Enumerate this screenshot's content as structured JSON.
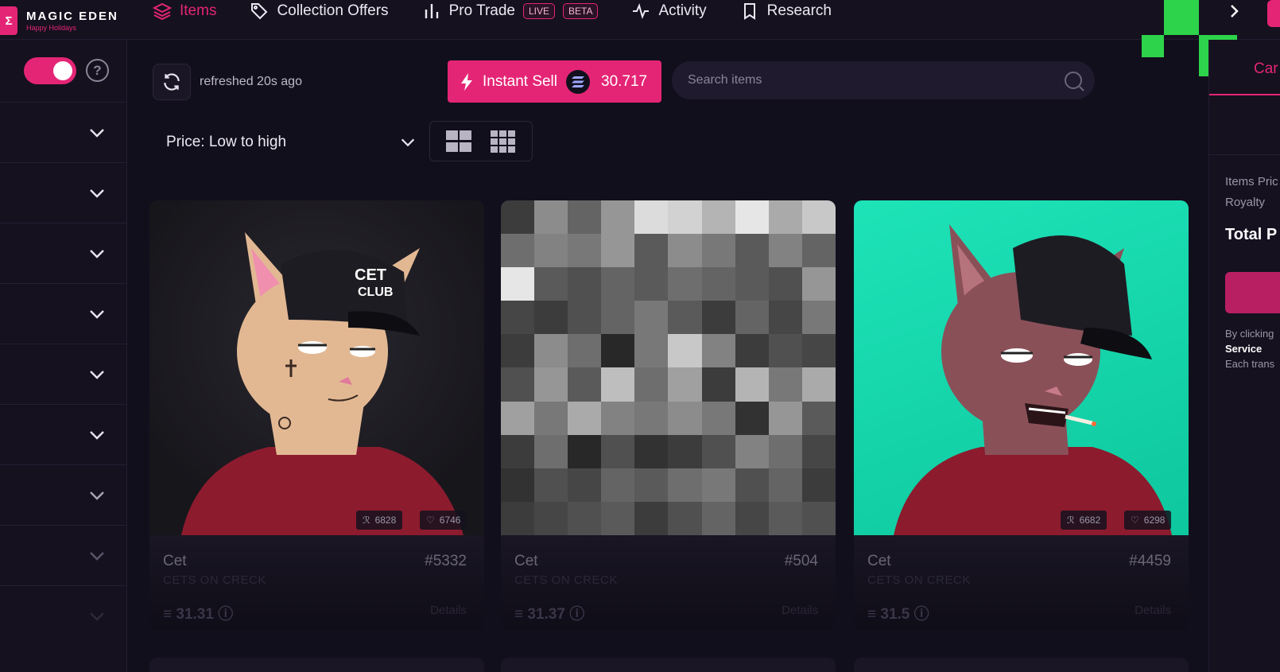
{
  "brand": {
    "name": "MAGIC EDEN",
    "tagline": "Happy Holidays"
  },
  "nav": {
    "tabs": [
      {
        "label": "Items",
        "icon": "layers-icon",
        "active": true
      },
      {
        "label": "Collection Offers",
        "icon": "tag-icon"
      },
      {
        "label": "Pro Trade",
        "icon": "bar-chart-icon",
        "badges": [
          "LIVE",
          "BETA"
        ]
      },
      {
        "label": "Activity",
        "icon": "activity-icon"
      },
      {
        "label": "Research",
        "icon": "bookmark-icon"
      }
    ]
  },
  "toolbar": {
    "refresh_text": "refreshed 20s ago",
    "instant_sell_label": "Instant Sell",
    "instant_sell_value": "30.717",
    "search_placeholder": "Search items",
    "sort_label": "Price: Low to high"
  },
  "cards": [
    {
      "name": "Cet",
      "number": "#5332",
      "collection": "CETS ON CRECK",
      "price": "31.31",
      "details": "Details",
      "rank": "6828",
      "likes": "6746",
      "cap_text": [
        "CET",
        "CLUB"
      ]
    },
    {
      "name": "Cet",
      "number": "#504",
      "collection": "CETS ON CRECK",
      "price": "31.37",
      "details": "Details"
    },
    {
      "name": "Cet",
      "number": "#4459",
      "collection": "CETS ON CRECK",
      "price": "31.5",
      "details": "Details",
      "rank": "6682",
      "likes": "6298"
    }
  ],
  "right_panel": {
    "tab_label": "Car",
    "items_price_label": "Items Pric",
    "royalty_label": "Royalty",
    "total_label": "Total P",
    "terms_1": "By clicking",
    "terms_2": "Service",
    "terms_3": "Each trans"
  },
  "colors": {
    "accent": "#e42575",
    "background": "#120f1d",
    "panel": "#15111f",
    "deco_green": "#2dd34a",
    "teal_card": "#17e0b4"
  }
}
